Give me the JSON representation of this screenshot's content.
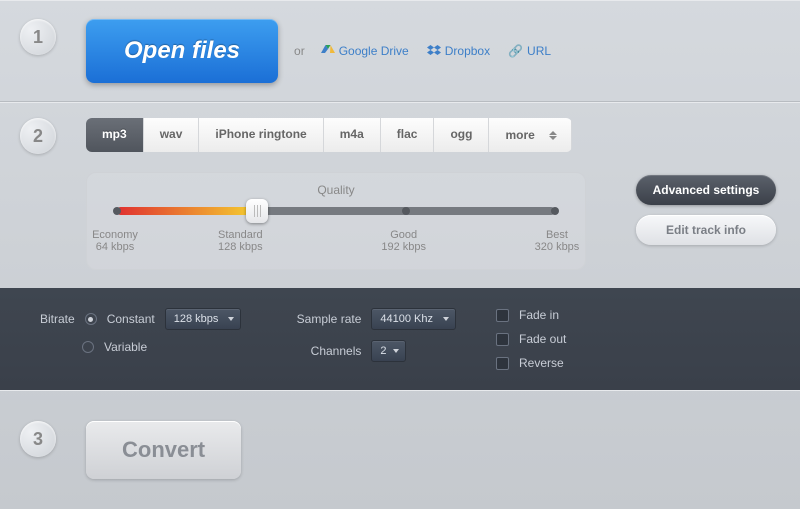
{
  "steps": {
    "one": "1",
    "two": "2",
    "three": "3"
  },
  "open": {
    "button": "Open files",
    "or": "or",
    "gdrive": "Google Drive",
    "dropbox": "Dropbox",
    "url": "URL"
  },
  "tabs": [
    "mp3",
    "wav",
    "iPhone ringtone",
    "m4a",
    "flac",
    "ogg",
    "more"
  ],
  "activeTab": 0,
  "quality": {
    "title": "Quality",
    "stops": [
      {
        "name": "Economy",
        "rate": "64 kbps"
      },
      {
        "name": "Standard",
        "rate": "128 kbps"
      },
      {
        "name": "Good",
        "rate": "192 kbps"
      },
      {
        "name": "Best",
        "rate": "320 kbps"
      }
    ],
    "selected": 1
  },
  "side": {
    "advanced": "Advanced settings",
    "edit": "Edit track info"
  },
  "adv": {
    "bitrateLabel": "Bitrate",
    "constant": "Constant",
    "variable": "Variable",
    "bitrateMode": "constant",
    "bitrateValue": "128 kbps",
    "sampleRateLabel": "Sample rate",
    "sampleRate": "44100 Khz",
    "channelsLabel": "Channels",
    "channels": "2",
    "fadeIn": "Fade in",
    "fadeOut": "Fade out",
    "reverse": "Reverse"
  },
  "convert": "Convert"
}
